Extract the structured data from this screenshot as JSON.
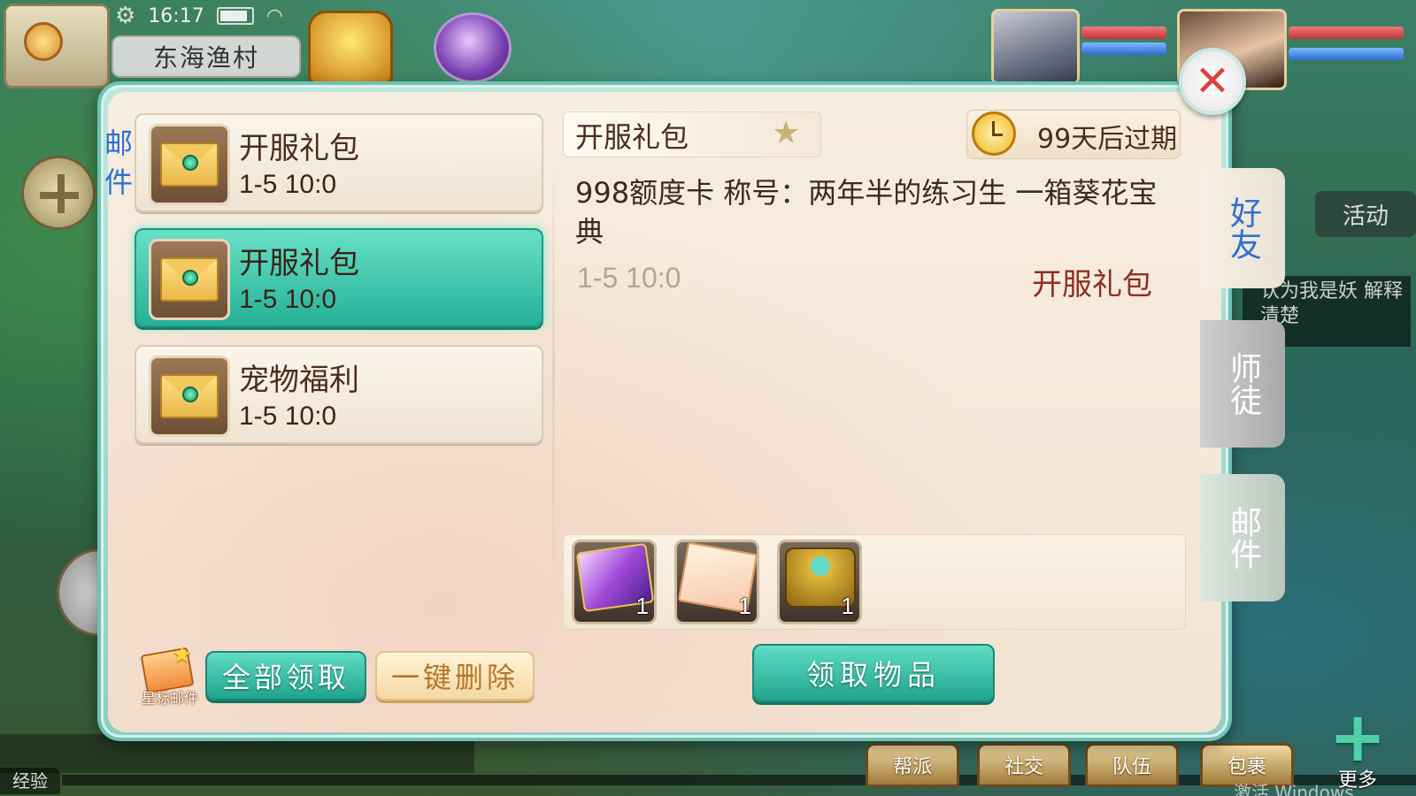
{
  "status": {
    "time": "16:17"
  },
  "location": "东海渔村",
  "mail_panel": {
    "title": "邮件",
    "mails": [
      {
        "title": "开服礼包",
        "date": "1-5 10:0",
        "selected": false
      },
      {
        "title": "开服礼包",
        "date": "1-5 10:0",
        "selected": true
      },
      {
        "title": "宠物福利",
        "date": "1-5 10:0",
        "selected": false
      }
    ],
    "star_mail_label": "星标邮件",
    "claim_all_label": "全部领取",
    "delete_all_label": "一键删除"
  },
  "detail": {
    "title": "开服礼包",
    "expire_text": "99天后过期",
    "body": "998额度卡 称号：两年半的练习生 一箱葵花宝典",
    "date": "1-5 10:0",
    "sender": "开服礼包",
    "attachments": [
      {
        "icon": "amount-card-icon",
        "count": "1"
      },
      {
        "icon": "title-scroll-icon",
        "count": "1"
      },
      {
        "icon": "treasure-chest-icon",
        "count": "1"
      }
    ],
    "claim_button_label": "领取物品"
  },
  "side_tabs": [
    {
      "label": "好友",
      "active": false
    },
    {
      "label": "师徒",
      "active": false
    },
    {
      "label": "邮件",
      "active": true
    }
  ],
  "background_hud": {
    "activity_label": "活动",
    "chat_text": "认为我是妖 解释清楚",
    "exp_label": "经验",
    "bottom_buttons": [
      "帮派",
      "社交",
      "队伍",
      "包裹"
    ],
    "more_label": "更多",
    "watermark": "激活 Windows"
  },
  "colors": {
    "accent": "#25b197",
    "tab_text": "#2f6fcf",
    "sender_text": "#8e2f22"
  }
}
